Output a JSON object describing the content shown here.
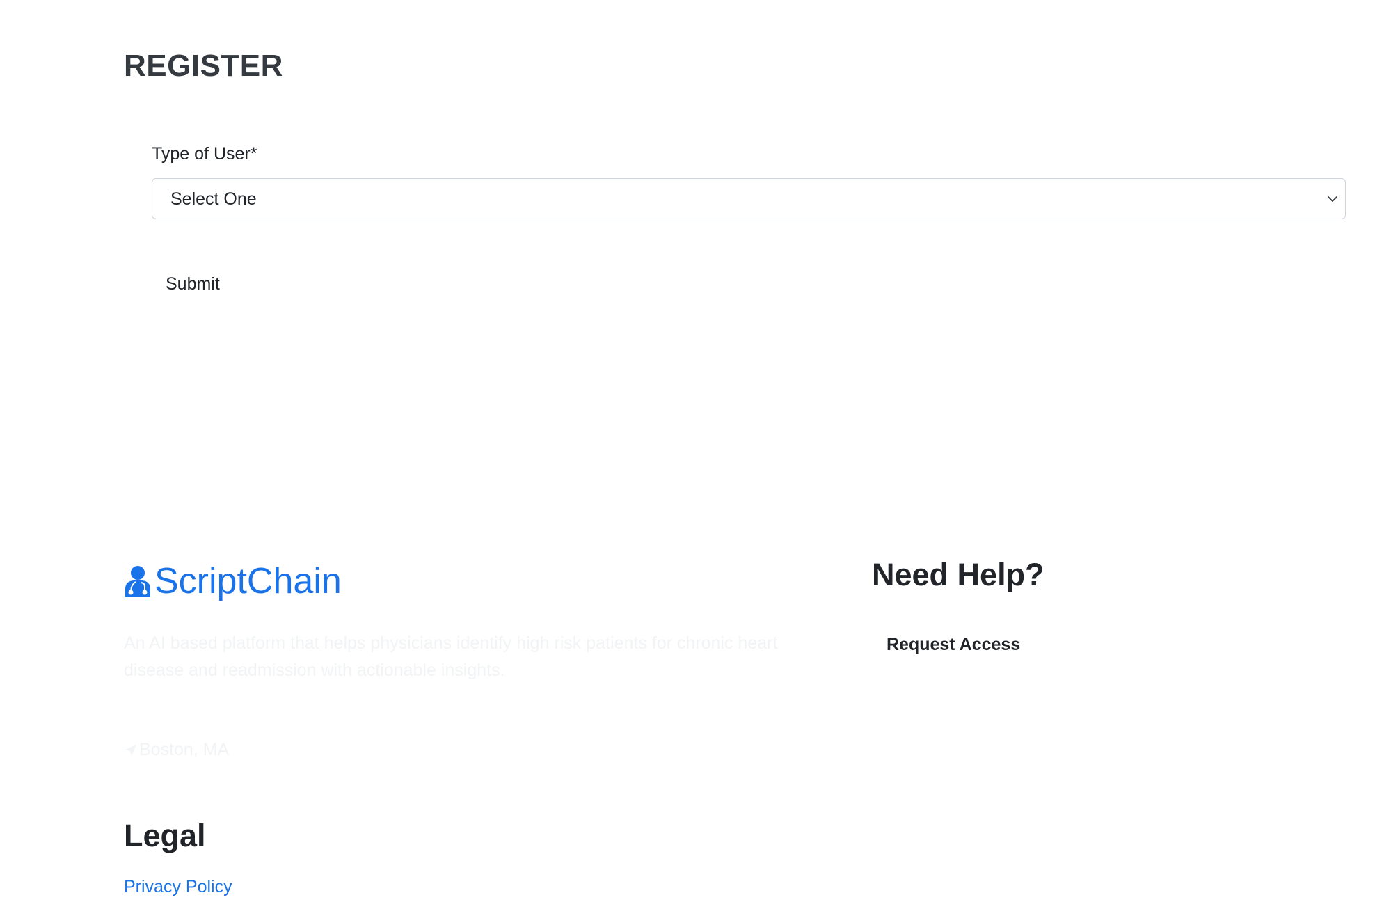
{
  "form": {
    "title": "REGISTER",
    "user_type_label": "Type of User*",
    "user_type_value": "Select One",
    "submit_label": "Submit"
  },
  "footer": {
    "brand_name": "ScriptChain",
    "description": "An AI based platform that helps physicians identify high risk patients for chronic heart disease and readmission with actionable insights.",
    "location": "Boston, MA",
    "help_title": "Need Help?",
    "request_access_label": "Request Access",
    "legal_title": "Legal",
    "privacy_policy_label": "Privacy Policy"
  },
  "colors": {
    "brand": "#1a73e8",
    "heading": "#343a40",
    "text": "#212529",
    "faded_text": "#f1f3f5",
    "input_border": "#ced4da"
  },
  "icons": {
    "brand_icon": "doctor-icon",
    "select_icon": "chevron-down-icon",
    "location_icon": "location-arrow-icon"
  }
}
